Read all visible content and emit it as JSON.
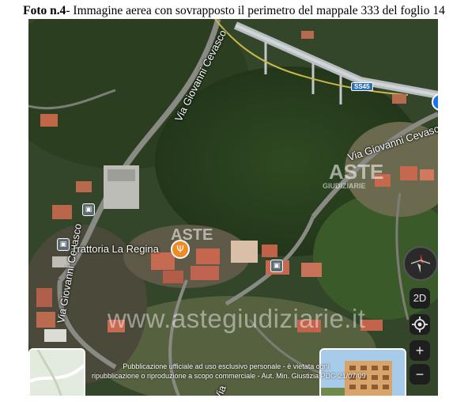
{
  "caption": {
    "label": "Foto n.4",
    "text": "- Immagine aerea  con sovrapposto il perimetro del mappale 333 del foglio 14"
  },
  "map": {
    "road_labels": {
      "top": "Via Giovanni Cevasco",
      "right": "Via Giovanni Cevasco",
      "left": "Via Giovanni Cevasco",
      "bottom": "Via"
    },
    "highway_shield": "SS45",
    "poi_label": "Trattoria La Regina",
    "watermark": {
      "url": "www.astegiudiziarie.it",
      "brand_top": "ASTE",
      "brand_mid": "ASTE",
      "brand_sub": "GIUDIZIARIE"
    },
    "notice": {
      "line1": "Pubblicazione ufficiale ad uso esclusivo personale - è vietata ogni",
      "line2": "ripubblicazione o riproduzione a scopo commerciale - Aut. Min. Giustizia PDG 21/07/09"
    },
    "controls": {
      "mode": "2D",
      "zoom_in": "+",
      "zoom_out": "−"
    }
  }
}
